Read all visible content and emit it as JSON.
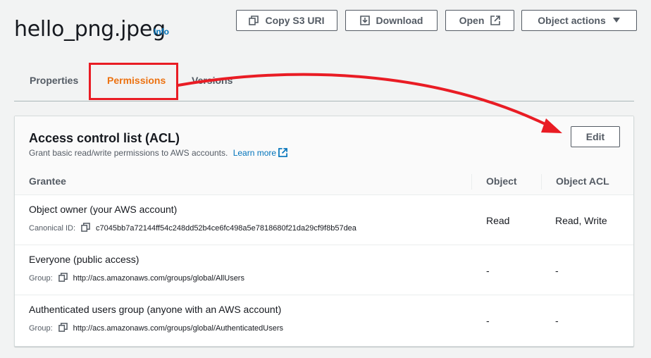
{
  "header": {
    "title": "hello_png.jpeg",
    "info_label": "Info",
    "buttons": {
      "copy_s3_uri": "Copy S3 URI",
      "download": "Download",
      "open": "Open",
      "object_actions": "Object actions"
    }
  },
  "tabs": [
    {
      "label": "Properties",
      "active": false
    },
    {
      "label": "Permissions",
      "active": true
    },
    {
      "label": "Versions",
      "active": false
    }
  ],
  "acl": {
    "title": "Access control list (ACL)",
    "description": "Grant basic read/write permissions to AWS accounts.",
    "learn_more": "Learn more",
    "edit_label": "Edit",
    "columns": {
      "grantee": "Grantee",
      "object": "Object",
      "object_acl": "Object ACL"
    },
    "rows": [
      {
        "grantee": "Object owner (your AWS account)",
        "id_label": "Canonical ID:",
        "id_value": "c7045bb7a72144ff54c248dd52b4ce6fc498a5e7818680f21da29cf9f8b57dea",
        "object": "Read",
        "object_acl": "Read, Write"
      },
      {
        "grantee": "Everyone (public access)",
        "id_label": "Group:",
        "id_value": "http://acs.amazonaws.com/groups/global/AllUsers",
        "object": "-",
        "object_acl": "-"
      },
      {
        "grantee": "Authenticated users group (anyone with an AWS account)",
        "id_label": "Group:",
        "id_value": "http://acs.amazonaws.com/groups/global/AuthenticatedUsers",
        "object": "-",
        "object_acl": "-"
      }
    ]
  },
  "colors": {
    "accent_orange": "#ec7211",
    "link_blue": "#0073bb",
    "annotation_red": "#e91c24"
  }
}
